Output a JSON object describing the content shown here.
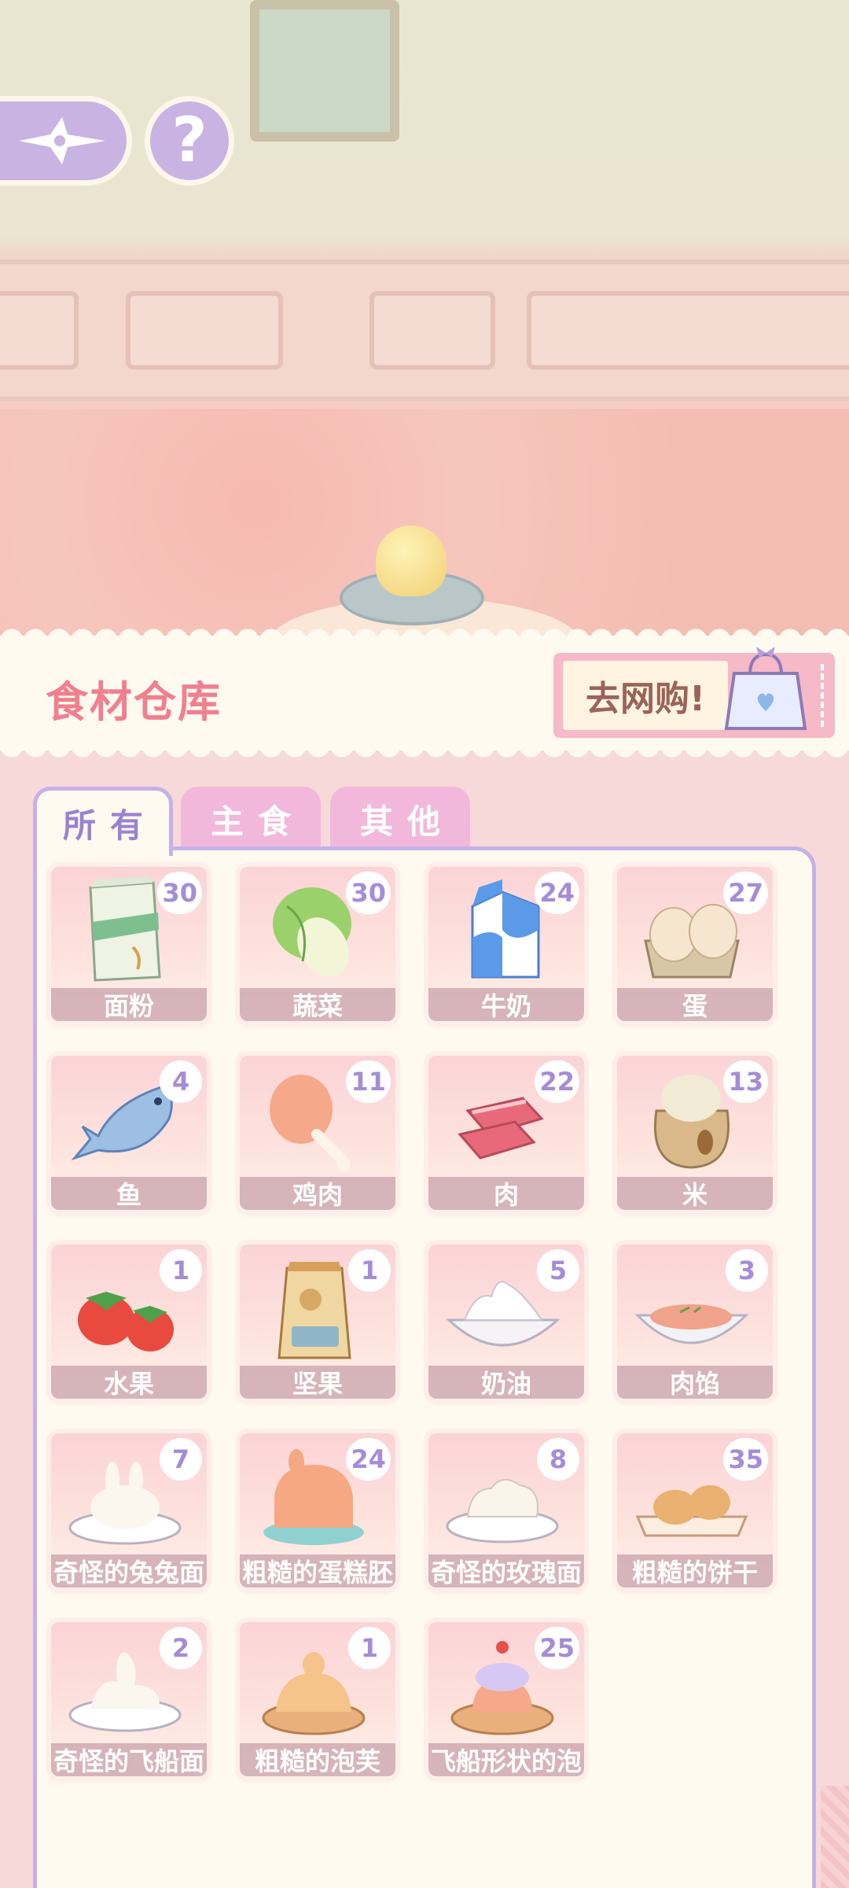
{
  "header": {
    "title": "食材仓库",
    "shop_label": "去网购!"
  },
  "tabs": [
    {
      "label": "所有",
      "active": true
    },
    {
      "label": "主食",
      "active": false
    },
    {
      "label": "其他",
      "active": false
    }
  ],
  "ingredients": [
    {
      "name": "面粉",
      "count": "30",
      "icon": "flour-bag-icon"
    },
    {
      "name": "蔬菜",
      "count": "30",
      "icon": "cabbage-icon"
    },
    {
      "name": "牛奶",
      "count": "24",
      "icon": "milk-carton-icon"
    },
    {
      "name": "蛋",
      "count": "27",
      "icon": "eggs-icon"
    },
    {
      "name": "鱼",
      "count": "4",
      "icon": "fish-icon"
    },
    {
      "name": "鸡肉",
      "count": "11",
      "icon": "chicken-leg-icon"
    },
    {
      "name": "肉",
      "count": "22",
      "icon": "meat-icon"
    },
    {
      "name": "米",
      "count": "13",
      "icon": "rice-sack-icon"
    },
    {
      "name": "水果",
      "count": "1",
      "icon": "strawberry-icon"
    },
    {
      "name": "坚果",
      "count": "1",
      "icon": "nuts-bag-icon"
    },
    {
      "name": "奶油",
      "count": "5",
      "icon": "cream-bowl-icon"
    },
    {
      "name": "肉馅",
      "count": "3",
      "icon": "minced-meat-bowl-icon"
    },
    {
      "name": "奇怪的兔兔面",
      "count": "7",
      "icon": "bunny-dough-icon"
    },
    {
      "name": "粗糙的蛋糕胚",
      "count": "24",
      "icon": "cake-base-icon"
    },
    {
      "name": "奇怪的玫瑰面",
      "count": "8",
      "icon": "rose-dough-icon"
    },
    {
      "name": "粗糙的饼干",
      "count": "35",
      "icon": "cookies-icon"
    },
    {
      "name": "奇怪的飞船面",
      "count": "2",
      "icon": "spaceship-dough-icon"
    },
    {
      "name": "粗糙的泡芙",
      "count": "1",
      "icon": "puff-icon"
    },
    {
      "name": "飞船形状的泡",
      "count": "25",
      "icon": "spaceship-puff-icon"
    }
  ],
  "colors": {
    "accent_purple": "#c5b1e8",
    "title_pink": "#f07f8f",
    "count_purple": "#a58cd8"
  }
}
